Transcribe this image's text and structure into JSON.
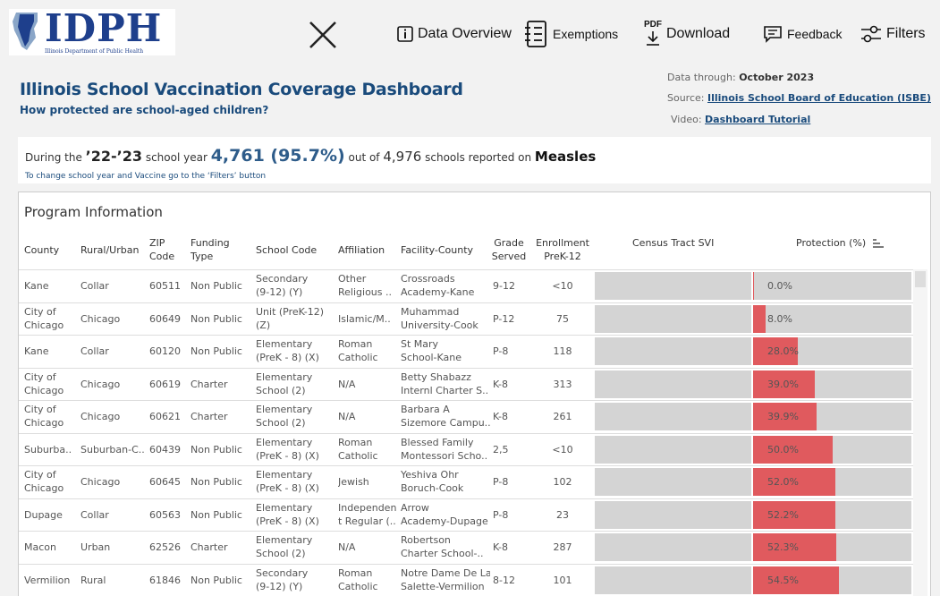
{
  "logo": {
    "text": "IDPH",
    "subtext": "Illinois Department of Public Health"
  },
  "toolbar": {
    "data_overview": "Data Overview",
    "exemptions": "Exemptions",
    "pdf_label": "PDF",
    "download": "Download",
    "feedback": "Feedback",
    "filters": "Filters"
  },
  "header": {
    "title": "Illinois School Vaccination Coverage Dashboard",
    "subtitle": "How protected are school-aged children?",
    "data_through_label": "Data through:",
    "data_through_value": "October 2023",
    "source_label": "Source:",
    "source_link": "Illinois School Board of Education (ISBE)",
    "video_label": "Video:",
    "video_link": "Dashboard Tutorial"
  },
  "summary": {
    "prefix": "During the ",
    "year": "’22-’23",
    "mid1": " school year ",
    "count": "4,761 (95.7%)",
    "mid2": " out of ",
    "total": "4,976",
    "mid3": " schools reported on ",
    "vaccine": "Measles",
    "hint": "To change school year and Vaccine go to the ‘Filters’ button"
  },
  "table": {
    "title": "Program Information",
    "headers": {
      "county": "County",
      "rural": "Rural/Urban",
      "zip1": "ZIP",
      "zip2": "Code",
      "funding1": "Funding",
      "funding2": "Type",
      "school_code": "School Code",
      "affiliation": "Affiliation",
      "facility": "Facility-County",
      "grade1": "Grade",
      "grade2": "Served",
      "enroll1": "Enrollment",
      "enroll2": "PreK-12",
      "svi": "Census Tract SVI",
      "protection": "Protection (%)"
    },
    "rows": [
      {
        "county": [
          "Kane",
          ""
        ],
        "rural": "Collar",
        "zip": "60511",
        "funding": "Non Public",
        "code": [
          "Secondary",
          "(9-12) (Y)"
        ],
        "affil": [
          "Other",
          "Religious .."
        ],
        "facility": [
          "Crossroads",
          "Academy-Kane"
        ],
        "grade": "9-12",
        "enroll": "<10",
        "protection": 0.0,
        "protection_label": "0.0%"
      },
      {
        "county": [
          "City of",
          "Chicago"
        ],
        "rural": "Chicago",
        "zip": "60649",
        "funding": "Non Public",
        "code": [
          "Unit (PreK-12)",
          "(Z)"
        ],
        "affil": [
          "Islamic/M..",
          ""
        ],
        "facility": [
          "Muhammad",
          "University-Cook"
        ],
        "grade": "P-12",
        "enroll": "75",
        "protection": 8.0,
        "protection_label": "8.0%"
      },
      {
        "county": [
          "Kane",
          ""
        ],
        "rural": "Collar",
        "zip": "60120",
        "funding": "Non Public",
        "code": [
          "Elementary",
          "(PreK - 8) (X)"
        ],
        "affil": [
          "Roman",
          "Catholic"
        ],
        "facility": [
          "St Mary",
          "School-Kane"
        ],
        "grade": "P-8",
        "enroll": "118",
        "protection": 28.0,
        "protection_label": "28.0%"
      },
      {
        "county": [
          "City of",
          "Chicago"
        ],
        "rural": "Chicago",
        "zip": "60619",
        "funding": "Charter",
        "code": [
          "Elementary",
          "School (2)"
        ],
        "affil": [
          "N/A",
          ""
        ],
        "facility": [
          "Betty Shabazz",
          "Internl Charter S.."
        ],
        "grade": "K-8",
        "enroll": "313",
        "protection": 39.0,
        "protection_label": "39.0%"
      },
      {
        "county": [
          "City of",
          "Chicago"
        ],
        "rural": "Chicago",
        "zip": "60621",
        "funding": "Charter",
        "code": [
          "Elementary",
          "School (2)"
        ],
        "affil": [
          "N/A",
          ""
        ],
        "facility": [
          "Barbara A",
          "Sizemore Campu.."
        ],
        "grade": "K-8",
        "enroll": "261",
        "protection": 39.9,
        "protection_label": "39.9%"
      },
      {
        "county": [
          "Suburba..",
          ""
        ],
        "rural": "Suburban-C..",
        "zip": "60439",
        "funding": "Non Public",
        "code": [
          "Elementary",
          "(PreK - 8) (X)"
        ],
        "affil": [
          "Roman",
          "Catholic"
        ],
        "facility": [
          "Blessed Family",
          "Montessori Scho.."
        ],
        "grade": "2,5",
        "enroll": "<10",
        "protection": 50.0,
        "protection_label": "50.0%"
      },
      {
        "county": [
          "City of",
          "Chicago"
        ],
        "rural": "Chicago",
        "zip": "60645",
        "funding": "Non Public",
        "code": [
          "Elementary",
          "(PreK - 8) (X)"
        ],
        "affil": [
          "Jewish",
          ""
        ],
        "facility": [
          "Yeshiva Ohr",
          "Boruch-Cook"
        ],
        "grade": "P-8",
        "enroll": "102",
        "protection": 52.0,
        "protection_label": "52.0%"
      },
      {
        "county": [
          "Dupage",
          ""
        ],
        "rural": "Collar",
        "zip": "60563",
        "funding": "Non Public",
        "code": [
          "Elementary",
          "(PreK - 8) (X)"
        ],
        "affil": [
          "Independen",
          "t Regular (.."
        ],
        "facility": [
          "Arrow",
          "Academy-Dupage"
        ],
        "grade": "P-8",
        "enroll": "23",
        "protection": 52.2,
        "protection_label": "52.2%"
      },
      {
        "county": [
          "Macon",
          ""
        ],
        "rural": "Urban",
        "zip": "62526",
        "funding": "Charter",
        "code": [
          "Elementary",
          "School (2)"
        ],
        "affil": [
          "N/A",
          ""
        ],
        "facility": [
          "Robertson",
          "Charter School-.."
        ],
        "grade": "K-8",
        "enroll": "287",
        "protection": 52.3,
        "protection_label": "52.3%"
      },
      {
        "county": [
          "Vermilion",
          ""
        ],
        "rural": "Rural",
        "zip": "61846",
        "funding": "Non Public",
        "code": [
          "Secondary",
          "(9-12) (Y)"
        ],
        "affil": [
          "Roman",
          "Catholic"
        ],
        "facility": [
          "Notre Dame De La",
          "Salette-Vermilion"
        ],
        "grade": "8-12",
        "enroll": "101",
        "protection": 54.5,
        "protection_label": "54.5%"
      }
    ]
  },
  "colors": {
    "accent": "#1a4b7c",
    "bar": "#e05a5e",
    "track": "#d4d4d4"
  }
}
